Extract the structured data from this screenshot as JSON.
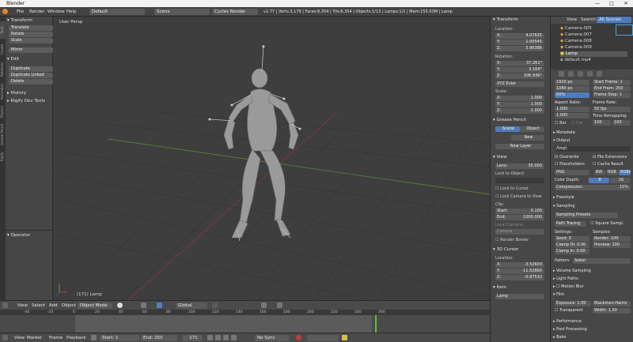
{
  "window": {
    "title": "Blender",
    "minimize": "—",
    "maximize": "□",
    "close": "✕"
  },
  "menu": {
    "items": [
      "File",
      "Render",
      "Window",
      "Help"
    ],
    "screen": "Default",
    "scene": "Scene",
    "engine": "Cycles Render",
    "stats": "v2.77 | Verts:3,179 | Faces:6,354 | Tris:6,354 | Objects:1/13 | Lamps:1/1 | Mem:155.03M | Lamp"
  },
  "tool_tabs": [
    "Tools",
    "Create",
    "Relations",
    "Animation",
    "Physics",
    "Grease Pencil",
    "Rigify"
  ],
  "toolshelf": {
    "transform_header": "Transform",
    "transform_buttons": [
      "Translate",
      "Rotate",
      "Scale",
      "Mirror"
    ],
    "edit_header": "Edit",
    "edit_buttons": [
      "Duplicate",
      "Duplicate Linked",
      "Delete"
    ],
    "history_header": "History",
    "rigify_header": "Rigify Dev Tools",
    "operator_header": "Operator"
  },
  "viewport": {
    "title": "User Persp",
    "status": "(171) Lamp"
  },
  "view_header": {
    "items": [
      "View",
      "Select",
      "Add",
      "Object"
    ],
    "mode": "Object Mode",
    "orientation": "Global"
  },
  "npanel": {
    "transform": "Transform",
    "location_label": "Location:",
    "location": [
      {
        "axis": "X:",
        "value": "4.07625"
      },
      {
        "axis": "Y:",
        "value": "1.00545"
      },
      {
        "axis": "Z:",
        "value": "5.90386"
      }
    ],
    "rotation_label": "Rotation:",
    "rotation": [
      {
        "axis": "X:",
        "value": "37.261°"
      },
      {
        "axis": "Y:",
        "value": "3.164°"
      },
      {
        "axis": "Z:",
        "value": "106.936°"
      }
    ],
    "rotation_mode": "XYZ Euler",
    "scale_label": "Scale:",
    "scale": [
      {
        "axis": "X:",
        "value": "1.000"
      },
      {
        "axis": "Y:",
        "value": "1.000"
      },
      {
        "axis": "Z:",
        "value": "1.000"
      }
    ],
    "grease_pencil": "Grease Pencil",
    "gp_tabs": [
      "Scene",
      "Object"
    ],
    "gp_new": "New",
    "gp_new_layer": "New Layer",
    "view": "View",
    "lens_label": "Lens:",
    "lens": "35.000",
    "lock_object": "Lock to Object:",
    "lock_cursor": "Lock to Cursor",
    "lock_camera": "Lock Camera to View",
    "clip_label": "Clip:",
    "clip_start_label": "Start:",
    "clip_start": "0.100",
    "clip_end_label": "End:",
    "clip_end": "1000.000",
    "local_camera": "Local Camera:",
    "local_camera_value": "Camera",
    "render_border": "Render Border",
    "cursor": "3D Cursor",
    "cursor_location_label": "Location:",
    "cursor_location": [
      {
        "axis": "X:",
        "value": "-3.52603"
      },
      {
        "axis": "Y:",
        "value": "-11.52860"
      },
      {
        "axis": "Z:",
        "value": "-0.87532"
      }
    ],
    "item": "Item",
    "item_name": "Lamp"
  },
  "outliner": {
    "menu": [
      "View",
      "Search",
      "All Scenes"
    ],
    "items": [
      "Camera.005",
      "Camera.007",
      "Camera.008",
      "Camera.009",
      "Lamp",
      "default.mp4"
    ]
  },
  "props": {
    "res_x": "1920 px",
    "res_y": "1080 px",
    "res_pct": "50%",
    "start_frame": "Start Frame: 1",
    "end_frame": "End Fram: 250",
    "frame_step": "Frame Step: 1",
    "aspect_label": "Aspect Ratio:",
    "aspect_x": "1.000",
    "aspect_y": "1.000",
    "frame_rate_label": "Frame Rate:",
    "fps": "50 fps",
    "time_remap": "Time Remapping:",
    "remap_old": "100",
    "remap_new": "100",
    "border": "Bor",
    "crop": "Cro",
    "metadata": "Metadata",
    "output": "Output",
    "output_path": "/tmp\\",
    "overwrite": "Overwrite",
    "file_ext": "File Extensions",
    "placeholders": "Placeholders",
    "cache_result": "Cache Result",
    "format": "PNG",
    "bw": "BW",
    "rgb": "RGB",
    "rgba": "RGBA",
    "color_depth_label": "Color Depth:",
    "depth_8": "8",
    "depth_16": "16",
    "compression_label": "Compression:",
    "compression": "15%",
    "freestyle": "Freestyle",
    "sampling": "Sampling",
    "sampling_presets": "Sampling Presets",
    "path_tracing": "Path Tracing",
    "square_samples": "Square Sampl.",
    "settings_label": "Settings:",
    "samples_label": "Samples:",
    "seed": "Seed: 0",
    "render_samples": "Render: 100",
    "clamp_direct": "Clamp Di: 0.00",
    "preview_samples": "Preview: 100",
    "clamp_indirect": "Clamp In: 0.00",
    "pattern_label": "Pattern:",
    "pattern": "Sobol",
    "sections": [
      "Volume Sampling",
      "Light Paths",
      "Motion Blur",
      "Film"
    ],
    "exposure": "Exposure: 1.00",
    "filter": "Blackman-Harris",
    "transparent": "Transparent",
    "width": "Width: 1.50",
    "performance": "Performance",
    "post_processing": "Post Processing",
    "bake": "Bake"
  },
  "timeline": {
    "ruler": [
      "-40",
      "-20",
      "0",
      "20",
      "40",
      "60",
      "80",
      "100",
      "120",
      "140",
      "160",
      "180",
      "200",
      "220",
      "240",
      "260"
    ],
    "menu": [
      "View",
      "Marker",
      "Frame",
      "Playback"
    ],
    "start": "Start:",
    "start_val": "1",
    "end": "End:",
    "end_val": "250",
    "current": "171",
    "sync": "No Sync"
  },
  "colors": {
    "accent": "#5680c2",
    "active_blue": "#4f7bbd",
    "grid": "#363636"
  }
}
